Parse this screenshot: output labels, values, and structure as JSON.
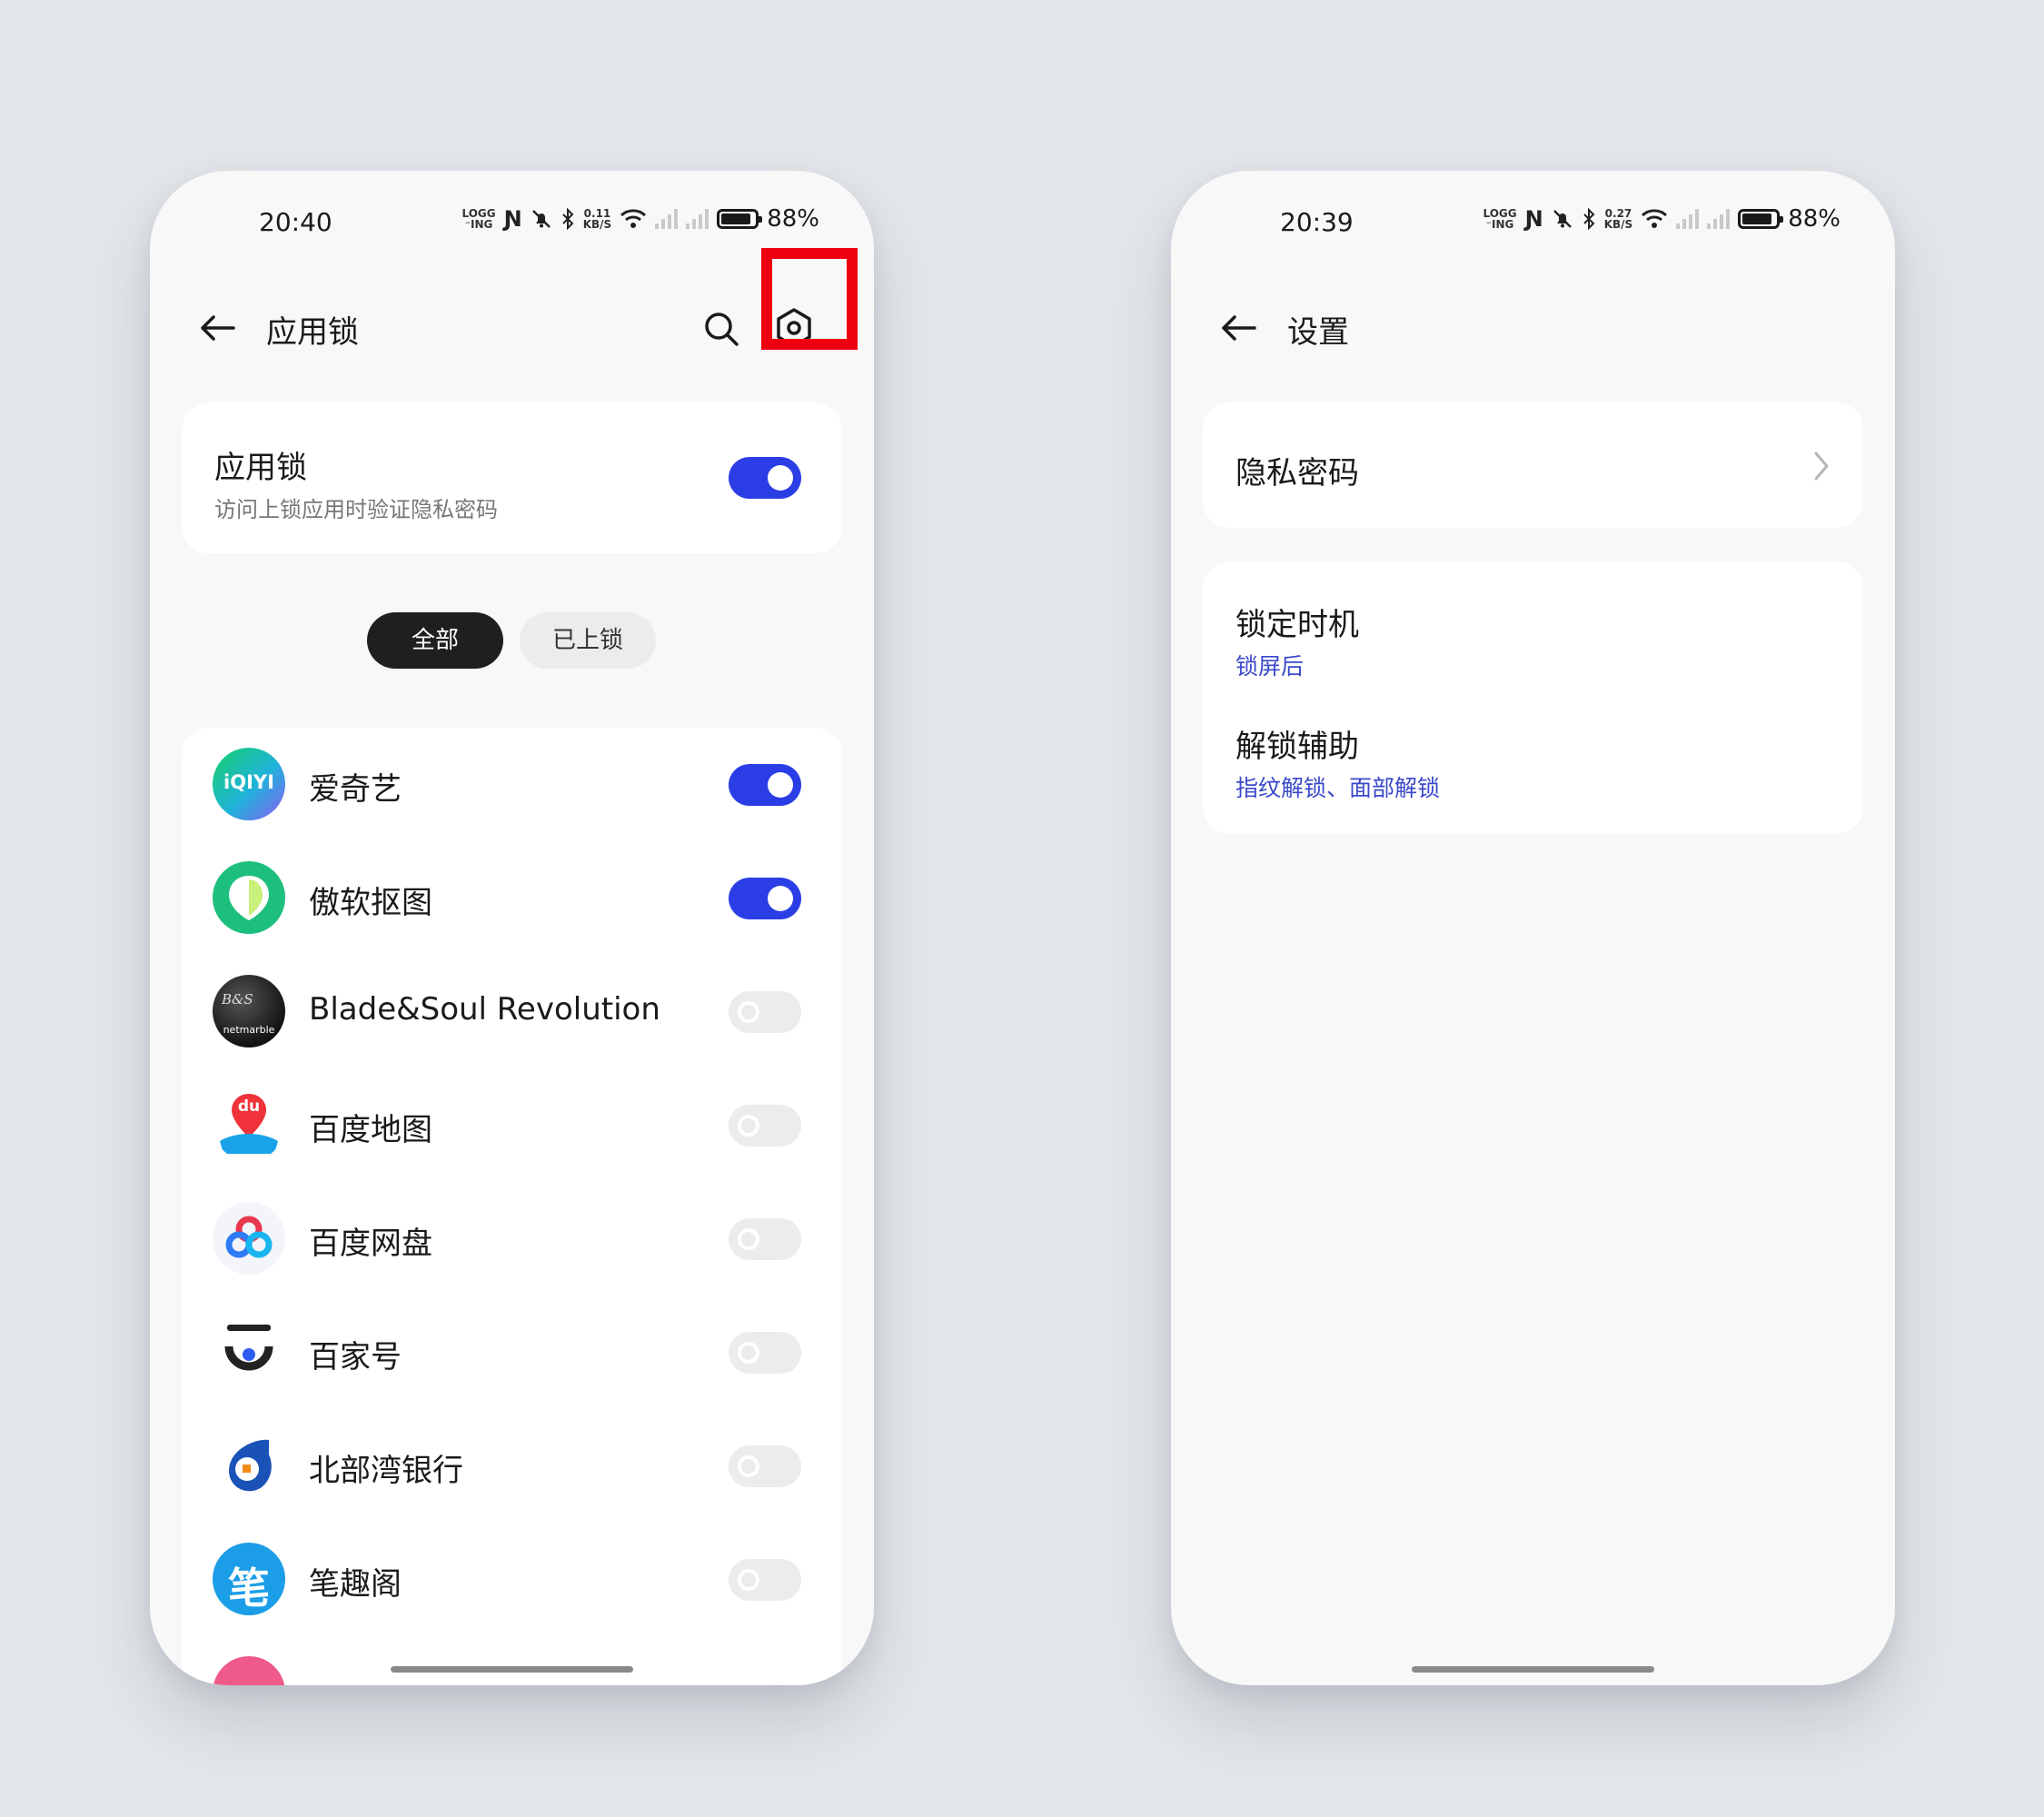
{
  "left_screen": {
    "status": {
      "time": "20:40",
      "net_top": "0.11",
      "net_bottom": "KB/S",
      "battery": "88%"
    },
    "title": "应用锁",
    "master": {
      "title": "应用锁",
      "subtitle": "访问上锁应用时验证隐私密码",
      "enabled": true
    },
    "filters": [
      {
        "label": "全部",
        "active": true
      },
      {
        "label": "已上锁",
        "active": false
      }
    ],
    "apps": [
      {
        "name": "爱奇艺",
        "locked": true,
        "icon": "iqiyi-icon",
        "icon_text": "iQIYI"
      },
      {
        "name": "傲软抠图",
        "locked": true,
        "icon": "aoruan-koutu-icon"
      },
      {
        "name": "Blade&Soul Revolution",
        "locked": false,
        "icon": "blade-soul-icon",
        "icon_text": "netmarble"
      },
      {
        "name": "百度地图",
        "locked": false,
        "icon": "baidu-map-icon",
        "icon_text": "du"
      },
      {
        "name": "百度网盘",
        "locked": false,
        "icon": "baidu-netdisk-icon"
      },
      {
        "name": "百家号",
        "locked": false,
        "icon": "baijiahao-icon"
      },
      {
        "name": "北部湾银行",
        "locked": false,
        "icon": "beibuwan-bank-icon"
      },
      {
        "name": "笔趣阁",
        "locked": false,
        "icon": "biquge-icon",
        "icon_text": "笔"
      }
    ]
  },
  "right_screen": {
    "status": {
      "time": "20:39",
      "net_top": "0.27",
      "net_bottom": "KB/S",
      "battery": "88%"
    },
    "title": "设置",
    "privacy_password": {
      "title": "隐私密码"
    },
    "lock_timing": {
      "title": "锁定时机",
      "value": "锁屏后"
    },
    "unlock_assist": {
      "title": "解锁辅助",
      "value": "指纹解锁、面部解锁"
    }
  },
  "colors": {
    "accent": "#2b3ee6",
    "highlight": "#ef0010",
    "link": "#3a49c9"
  }
}
